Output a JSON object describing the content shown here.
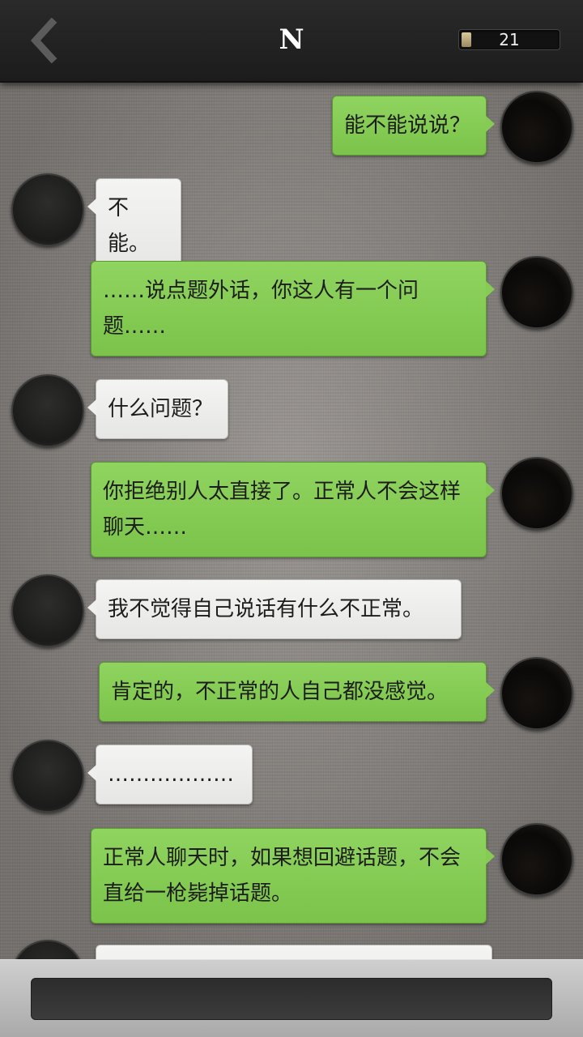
{
  "header": {
    "back_icon": "chevron-left-icon",
    "title": "N",
    "counter": {
      "value": "21",
      "level": 0.1
    }
  },
  "messages": [
    {
      "from": "user",
      "text": "能不能说说？"
    },
    {
      "from": "N",
      "text": "不能。"
    },
    {
      "from": "user",
      "text": "……说点题外话，你这人有一个问题……"
    },
    {
      "from": "N",
      "text": "什么问题？"
    },
    {
      "from": "user",
      "text": "你拒绝别人太直接了。正常人不会这样聊天……"
    },
    {
      "from": "N",
      "text": "我不觉得自己说话有什么不正常。"
    },
    {
      "from": "user",
      "text": "肯定的，不正常的人自己都没感觉。"
    },
    {
      "from": "N",
      "text": "………………"
    },
    {
      "from": "user",
      "text": "正常人聊天时，如果想回避话题，不会直给一枪毙掉话题。"
    },
    {
      "from": "N",
      "text": ""
    }
  ],
  "input": {
    "value": "",
    "placeholder": ""
  },
  "colors": {
    "user_bubble": "#85cb54",
    "n_bubble": "#efefed",
    "header_bg": "#222222",
    "background": "#8e8985"
  }
}
